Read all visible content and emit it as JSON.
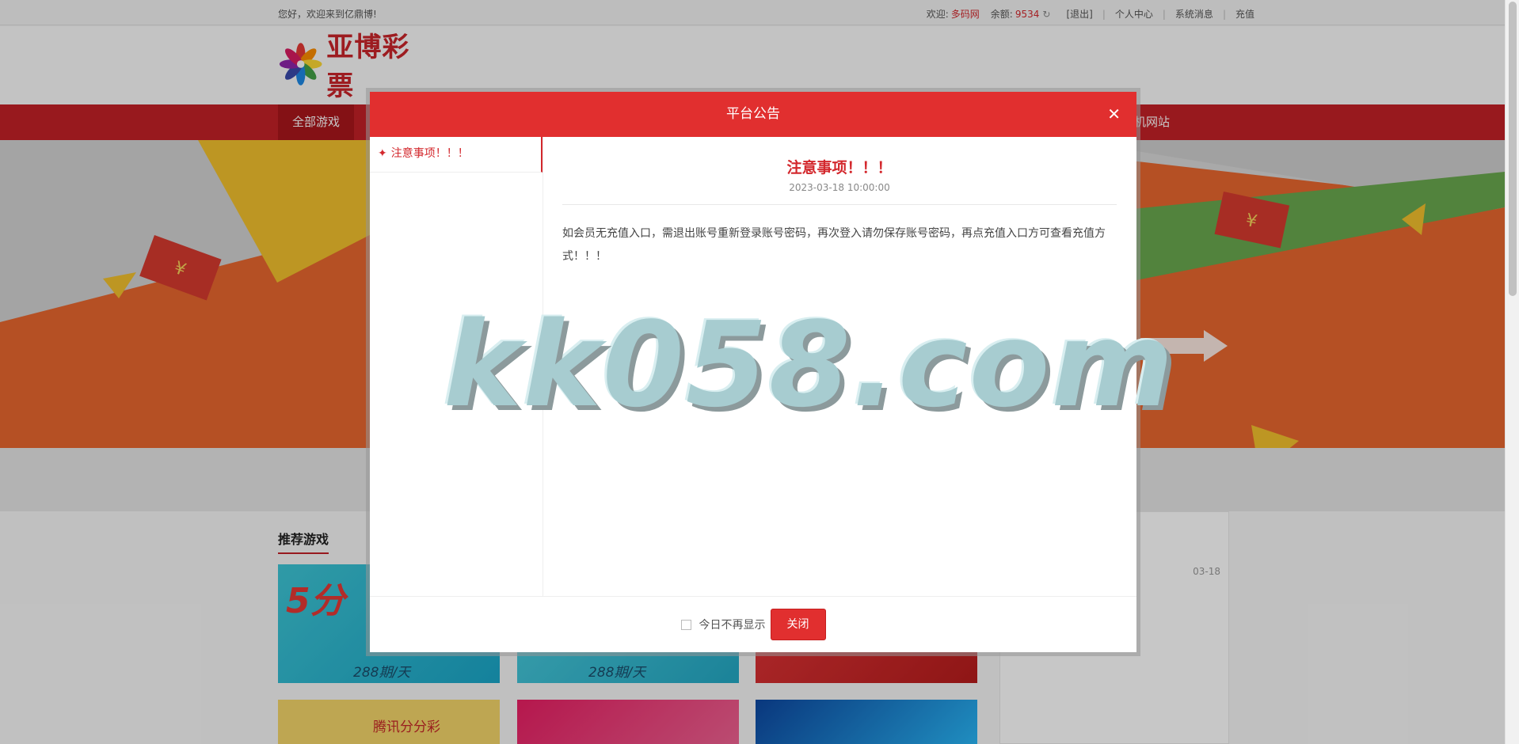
{
  "topbar": {
    "greeting": "您好，欢迎来到亿鼎博!",
    "welcome_label": "欢迎:",
    "username": "多码网",
    "balance_label": "余额:",
    "balance": "9534",
    "logout": "[退出]",
    "user_center": "个人中心",
    "messages": "系统消息",
    "recharge": "充值"
  },
  "header": {
    "logo_text": "亚博彩票"
  },
  "nav": {
    "all_games": "全部游戏",
    "mobile_site": "机网站"
  },
  "content": {
    "section_title": "推荐游戏",
    "news_date": "03-18",
    "card_text_1": "288期/天",
    "card_text_2": "288期/天",
    "card_text_3": "腾讯分分彩"
  },
  "modal": {
    "title": "平台公告",
    "close_icon": "close-icon",
    "side_items": [
      {
        "label": "注意事项！！！"
      }
    ],
    "notice": {
      "title": "注意事项！！！",
      "time": "2023-03-18 10:00:00",
      "body": "如会员无充值入口，需退出账号重新登录账号密码，再次登入请勿保存账号密码，再点充值入口方可查看充值方式！！！"
    },
    "footer": {
      "dont_show_label": "今日不再显示",
      "close_button": "关闭"
    }
  },
  "watermark": "kk058.com",
  "colors": {
    "brand_red": "#e12f2f",
    "nav_red": "#c32027"
  }
}
